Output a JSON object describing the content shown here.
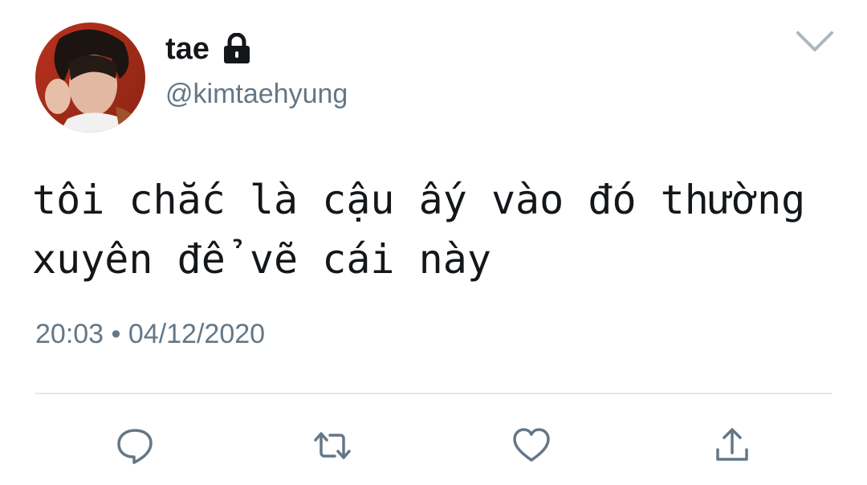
{
  "tweet": {
    "author": {
      "display_name": "tae",
      "handle": "@kimtaehyung",
      "protected_icon": "lock-icon",
      "avatar": "profile-photo"
    },
    "text": "tôi chắc là cậu ấy vào đó thường\nxuyên để vẽ cái này",
    "timestamp": "20:03 • 04/12/2020",
    "menu_icon": "chevron-down-icon",
    "actions": [
      {
        "name": "reply",
        "icon": "reply-icon"
      },
      {
        "name": "retweet",
        "icon": "retweet-icon"
      },
      {
        "name": "like",
        "icon": "heart-icon"
      },
      {
        "name": "share",
        "icon": "share-icon"
      }
    ],
    "colors": {
      "text_primary": "#14171a",
      "text_secondary": "#657786",
      "divider": "#e1e8ed",
      "icon": "#657786"
    }
  }
}
